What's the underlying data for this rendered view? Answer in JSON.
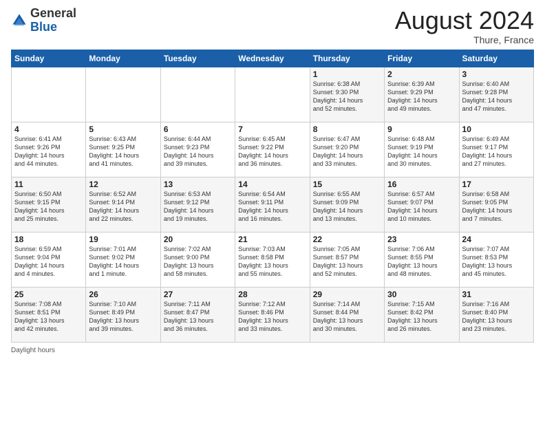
{
  "header": {
    "logo_general": "General",
    "logo_blue": "Blue",
    "title": "August 2024",
    "subtitle": "Thure, France"
  },
  "footer": {
    "daylight_label": "Daylight hours"
  },
  "days_of_week": [
    "Sunday",
    "Monday",
    "Tuesday",
    "Wednesday",
    "Thursday",
    "Friday",
    "Saturday"
  ],
  "weeks": [
    [
      {
        "day": "",
        "info": ""
      },
      {
        "day": "",
        "info": ""
      },
      {
        "day": "",
        "info": ""
      },
      {
        "day": "",
        "info": ""
      },
      {
        "day": "1",
        "info": "Sunrise: 6:38 AM\nSunset: 9:30 PM\nDaylight: 14 hours\nand 52 minutes."
      },
      {
        "day": "2",
        "info": "Sunrise: 6:39 AM\nSunset: 9:29 PM\nDaylight: 14 hours\nand 49 minutes."
      },
      {
        "day": "3",
        "info": "Sunrise: 6:40 AM\nSunset: 9:28 PM\nDaylight: 14 hours\nand 47 minutes."
      }
    ],
    [
      {
        "day": "4",
        "info": "Sunrise: 6:41 AM\nSunset: 9:26 PM\nDaylight: 14 hours\nand 44 minutes."
      },
      {
        "day": "5",
        "info": "Sunrise: 6:43 AM\nSunset: 9:25 PM\nDaylight: 14 hours\nand 41 minutes."
      },
      {
        "day": "6",
        "info": "Sunrise: 6:44 AM\nSunset: 9:23 PM\nDaylight: 14 hours\nand 39 minutes."
      },
      {
        "day": "7",
        "info": "Sunrise: 6:45 AM\nSunset: 9:22 PM\nDaylight: 14 hours\nand 36 minutes."
      },
      {
        "day": "8",
        "info": "Sunrise: 6:47 AM\nSunset: 9:20 PM\nDaylight: 14 hours\nand 33 minutes."
      },
      {
        "day": "9",
        "info": "Sunrise: 6:48 AM\nSunset: 9:19 PM\nDaylight: 14 hours\nand 30 minutes."
      },
      {
        "day": "10",
        "info": "Sunrise: 6:49 AM\nSunset: 9:17 PM\nDaylight: 14 hours\nand 27 minutes."
      }
    ],
    [
      {
        "day": "11",
        "info": "Sunrise: 6:50 AM\nSunset: 9:15 PM\nDaylight: 14 hours\nand 25 minutes."
      },
      {
        "day": "12",
        "info": "Sunrise: 6:52 AM\nSunset: 9:14 PM\nDaylight: 14 hours\nand 22 minutes."
      },
      {
        "day": "13",
        "info": "Sunrise: 6:53 AM\nSunset: 9:12 PM\nDaylight: 14 hours\nand 19 minutes."
      },
      {
        "day": "14",
        "info": "Sunrise: 6:54 AM\nSunset: 9:11 PM\nDaylight: 14 hours\nand 16 minutes."
      },
      {
        "day": "15",
        "info": "Sunrise: 6:55 AM\nSunset: 9:09 PM\nDaylight: 14 hours\nand 13 minutes."
      },
      {
        "day": "16",
        "info": "Sunrise: 6:57 AM\nSunset: 9:07 PM\nDaylight: 14 hours\nand 10 minutes."
      },
      {
        "day": "17",
        "info": "Sunrise: 6:58 AM\nSunset: 9:05 PM\nDaylight: 14 hours\nand 7 minutes."
      }
    ],
    [
      {
        "day": "18",
        "info": "Sunrise: 6:59 AM\nSunset: 9:04 PM\nDaylight: 14 hours\nand 4 minutes."
      },
      {
        "day": "19",
        "info": "Sunrise: 7:01 AM\nSunset: 9:02 PM\nDaylight: 14 hours\nand 1 minute."
      },
      {
        "day": "20",
        "info": "Sunrise: 7:02 AM\nSunset: 9:00 PM\nDaylight: 13 hours\nand 58 minutes."
      },
      {
        "day": "21",
        "info": "Sunrise: 7:03 AM\nSunset: 8:58 PM\nDaylight: 13 hours\nand 55 minutes."
      },
      {
        "day": "22",
        "info": "Sunrise: 7:05 AM\nSunset: 8:57 PM\nDaylight: 13 hours\nand 52 minutes."
      },
      {
        "day": "23",
        "info": "Sunrise: 7:06 AM\nSunset: 8:55 PM\nDaylight: 13 hours\nand 48 minutes."
      },
      {
        "day": "24",
        "info": "Sunrise: 7:07 AM\nSunset: 8:53 PM\nDaylight: 13 hours\nand 45 minutes."
      }
    ],
    [
      {
        "day": "25",
        "info": "Sunrise: 7:08 AM\nSunset: 8:51 PM\nDaylight: 13 hours\nand 42 minutes."
      },
      {
        "day": "26",
        "info": "Sunrise: 7:10 AM\nSunset: 8:49 PM\nDaylight: 13 hours\nand 39 minutes."
      },
      {
        "day": "27",
        "info": "Sunrise: 7:11 AM\nSunset: 8:47 PM\nDaylight: 13 hours\nand 36 minutes."
      },
      {
        "day": "28",
        "info": "Sunrise: 7:12 AM\nSunset: 8:46 PM\nDaylight: 13 hours\nand 33 minutes."
      },
      {
        "day": "29",
        "info": "Sunrise: 7:14 AM\nSunset: 8:44 PM\nDaylight: 13 hours\nand 30 minutes."
      },
      {
        "day": "30",
        "info": "Sunrise: 7:15 AM\nSunset: 8:42 PM\nDaylight: 13 hours\nand 26 minutes."
      },
      {
        "day": "31",
        "info": "Sunrise: 7:16 AM\nSunset: 8:40 PM\nDaylight: 13 hours\nand 23 minutes."
      }
    ]
  ]
}
